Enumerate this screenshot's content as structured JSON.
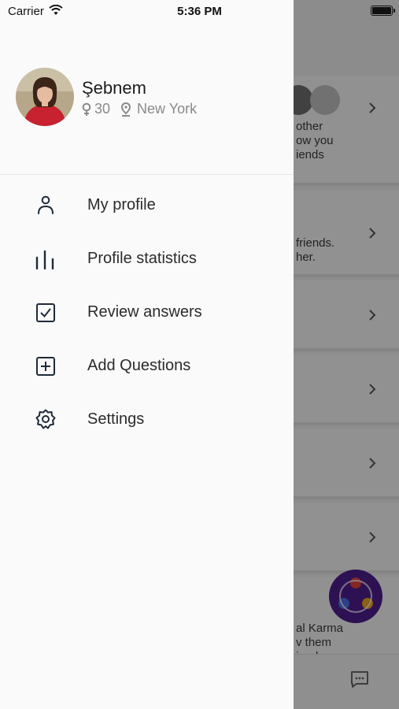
{
  "status_bar": {
    "carrier": "Carrier",
    "time": "5:36 PM"
  },
  "drawer": {
    "profile": {
      "name": "Şebnem",
      "age": "30",
      "city": "New York"
    },
    "menu": [
      {
        "label": "My profile",
        "icon": "person-icon"
      },
      {
        "label": "Profile statistics",
        "icon": "bar-chart-icon"
      },
      {
        "label": "Review answers",
        "icon": "checkbox-icon"
      },
      {
        "label": "Add Questions",
        "icon": "plus-square-icon"
      },
      {
        "label": "Settings",
        "icon": "gear-icon"
      }
    ]
  },
  "background": {
    "card1_lines": [
      "other",
      "ow you",
      "iends"
    ],
    "card2_lines": [
      "friends.",
      "her."
    ],
    "card7_lines": [
      "al Karma",
      "v them",
      "iends"
    ]
  },
  "colors": {
    "fab": "#4b1d8a",
    "drawer": "#fafafa",
    "overlay": "rgba(0,0,0,0.4)"
  }
}
